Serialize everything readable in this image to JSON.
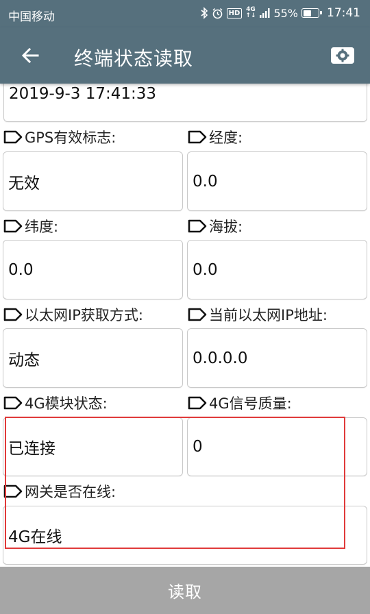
{
  "status_bar": {
    "carrier": "中国移动",
    "network_type": "4G",
    "battery_percent": "55%",
    "battery_level": 0.55,
    "time": "17:41",
    "icons": [
      "bluetooth-icon",
      "alarm-icon",
      "hd-icon",
      "signal-icon",
      "battery-icon"
    ]
  },
  "app_bar": {
    "title": "终端状态读取",
    "back_icon": "back-arrow-icon",
    "settings_icon": "settings-icon"
  },
  "fields": {
    "datetime": {
      "value": "2019-9-3 17:41:33"
    },
    "gps_valid": {
      "label": "GPS有效标志:",
      "value": "无效"
    },
    "longitude": {
      "label": "经度:",
      "value": "0.0"
    },
    "latitude": {
      "label": "纬度:",
      "value": "0.0"
    },
    "altitude": {
      "label": "海拔:",
      "value": "0.0"
    },
    "eth_ip_mode": {
      "label": "以太网IP获取方式:",
      "value": "动态"
    },
    "eth_ip_addr": {
      "label": "当前以太网IP地址:",
      "value": "0.0.0.0"
    },
    "module_4g_status": {
      "label": "4G模块状态:",
      "value": "已连接"
    },
    "signal_4g_quality": {
      "label": "4G信号质量:",
      "value": "0"
    },
    "gateway_online": {
      "label": "网关是否在线:",
      "value": "4G在线"
    }
  },
  "read_button": {
    "label": "读取"
  },
  "colors": {
    "app_bar": "#56707d",
    "highlight_border": "#e03a3a",
    "bottom_button": "#a6a6a6"
  }
}
